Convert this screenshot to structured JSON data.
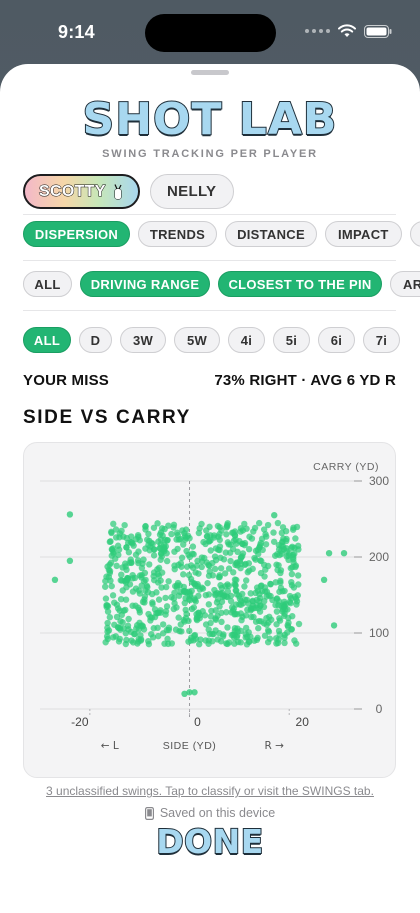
{
  "status": {
    "time": "9:14"
  },
  "app": {
    "title": "SHOT LAB",
    "subtitle": "SWING TRACKING PER PLAYER"
  },
  "players": [
    {
      "label": "SCOTTY",
      "active": true
    },
    {
      "label": "NELLY",
      "active": false
    }
  ],
  "views": [
    "DISPERSION",
    "TRENDS",
    "DISTANCE",
    "IMPACT"
  ],
  "sessions": [
    "ALL",
    "DRIVING RANGE",
    "CLOSEST TO THE PIN",
    "ARC"
  ],
  "clubs": [
    "ALL",
    "D",
    "3W",
    "5W",
    "4i",
    "5i",
    "6i",
    "7i"
  ],
  "miss": {
    "label": "YOUR MISS",
    "value": "73% RIGHT · AVG 6 YD R"
  },
  "section_title": "SIDE VS CARRY",
  "footer": {
    "unclassified": "3 unclassified swings. Tap to classify or visit the SWINGS tab.",
    "saved": "Saved on this device",
    "done": "DONE"
  },
  "colors": {
    "accent": "#22b573",
    "title_fill": "#a8d8f0",
    "point": "#2ecc7a"
  },
  "chart_data": {
    "type": "scatter",
    "xlabel": "SIDE (YD)",
    "ylabel": "CARRY (YD)",
    "x_left_hint": "← L",
    "x_right_hint": "R →",
    "xlim": [
      -30,
      33
    ],
    "ylim": [
      0,
      300
    ],
    "xticks": [
      -20,
      0,
      20
    ],
    "yticks": [
      0,
      100,
      200,
      300
    ],
    "grid": true,
    "outliers": [
      {
        "x": -24,
        "y": 256
      },
      {
        "x": -24,
        "y": 195
      },
      {
        "x": -27,
        "y": 170
      },
      {
        "x": 28,
        "y": 205
      },
      {
        "x": 31,
        "y": 205
      },
      {
        "x": 27,
        "y": 170
      },
      {
        "x": 29,
        "y": 110
      },
      {
        "x": 17,
        "y": 255
      },
      {
        "x": -1,
        "y": 20
      },
      {
        "x": 0,
        "y": 22
      },
      {
        "x": 1,
        "y": 22
      }
    ],
    "cluster": {
      "count": 780,
      "x_range": [
        -17,
        22
      ],
      "y_range": [
        85,
        245
      ]
    }
  }
}
